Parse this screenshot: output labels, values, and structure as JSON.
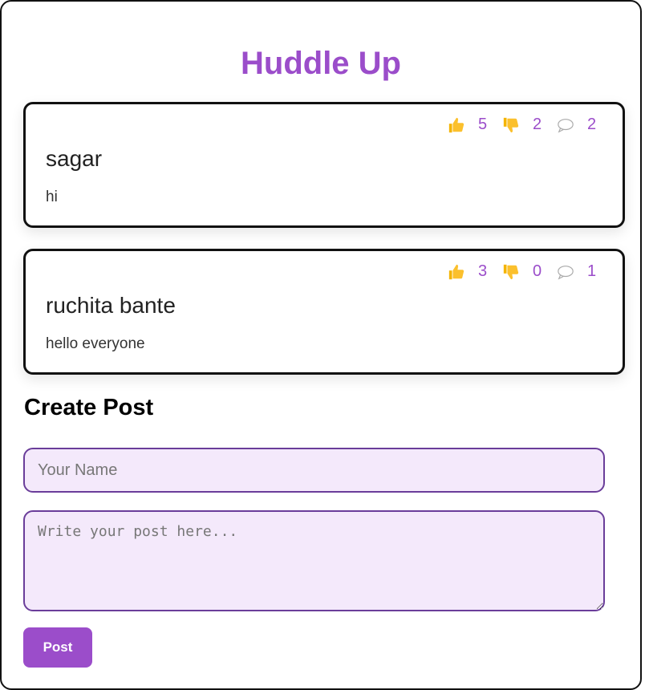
{
  "app": {
    "title": "Huddle Up",
    "accent_color": "#9b4dca"
  },
  "posts": [
    {
      "author": "sagar",
      "body": "hi",
      "likes": "5",
      "dislikes": "2",
      "comments": "2"
    },
    {
      "author": "ruchita bante",
      "body": "hello everyone",
      "likes": "3",
      "dislikes": "0",
      "comments": "1"
    }
  ],
  "icons": {
    "like": "thumbs-up-icon",
    "dislike": "thumbs-down-icon",
    "comment": "speech-bubble-icon"
  },
  "create_post": {
    "heading": "Create Post",
    "name_placeholder": "Your Name",
    "name_value": "",
    "body_placeholder": "Write your post here...",
    "body_value": "",
    "submit_label": "Post"
  }
}
